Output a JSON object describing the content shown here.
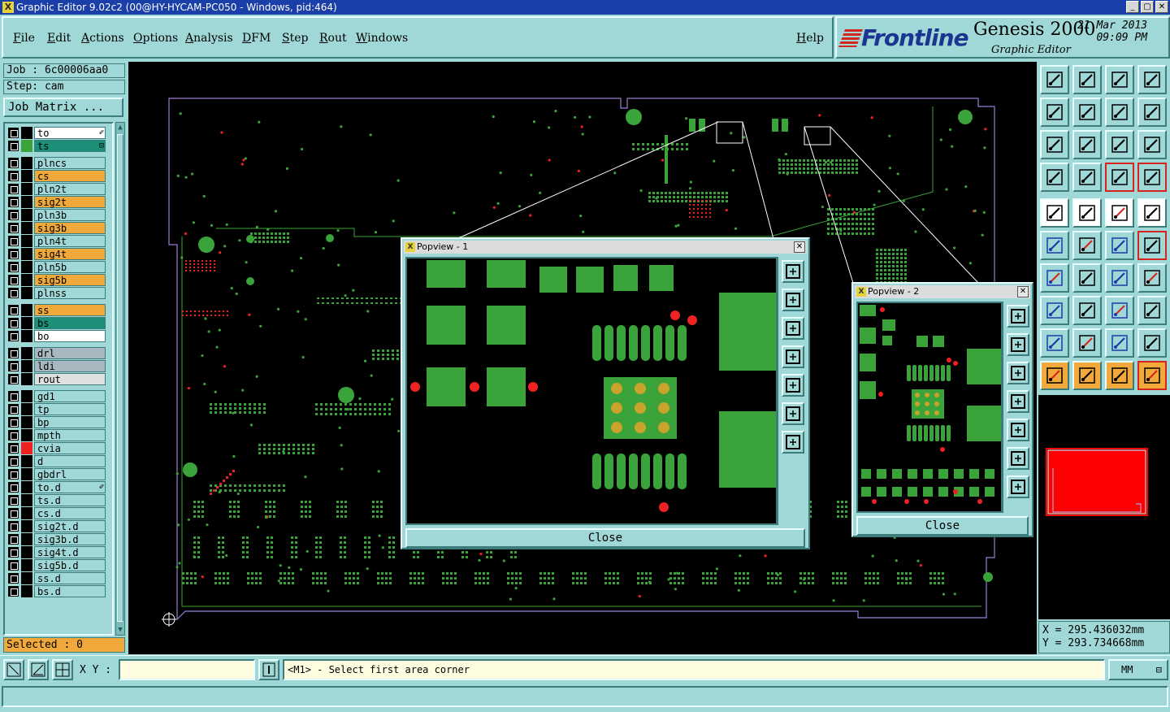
{
  "window": {
    "title": "Graphic Editor 9.02c2 (00@HY-HYCAM-PC050 - Windows, pid:464)",
    "controls": [
      "_",
      "▢",
      "✕"
    ]
  },
  "menu": {
    "items": [
      "File",
      "Edit",
      "Actions",
      "Options",
      "Analysis",
      "DFM",
      "Step",
      "Rout",
      "Windows"
    ],
    "help": "Help"
  },
  "brand": {
    "logo": "Frontline",
    "product": "Genesis 2000",
    "subtitle": "Graphic Editor",
    "date": "21 Mar 2013",
    "time": "09:09 PM"
  },
  "job": {
    "job_line": "Job : 6c00006aa0",
    "step_line": "Step: cam",
    "matrix_button": "Job Matrix ..."
  },
  "layers": [
    {
      "name": "to",
      "bg": "#ffffff",
      "swatch": "#000000",
      "mark": "✐"
    },
    {
      "name": "ts",
      "bg": "#1b8f77",
      "swatch": "#3aa33a",
      "mark": "⊡"
    },
    {
      "name": "plncs",
      "bg": "#9fd8d6",
      "swatch": "#000000",
      "mark": ""
    },
    {
      "name": "cs",
      "bg": "#f2a93b",
      "swatch": "#000000",
      "mark": ""
    },
    {
      "name": "pln2t",
      "bg": "#9fd8d6",
      "swatch": "#000000",
      "mark": ""
    },
    {
      "name": "sig2t",
      "bg": "#f2a93b",
      "swatch": "#000000",
      "mark": ""
    },
    {
      "name": "pln3b",
      "bg": "#9fd8d6",
      "swatch": "#000000",
      "mark": ""
    },
    {
      "name": "sig3b",
      "bg": "#f2a93b",
      "swatch": "#000000",
      "mark": ""
    },
    {
      "name": "pln4t",
      "bg": "#9fd8d6",
      "swatch": "#000000",
      "mark": ""
    },
    {
      "name": "sig4t",
      "bg": "#f2a93b",
      "swatch": "#000000",
      "mark": ""
    },
    {
      "name": "pln5b",
      "bg": "#9fd8d6",
      "swatch": "#000000",
      "mark": ""
    },
    {
      "name": "sig5b",
      "bg": "#f2a93b",
      "swatch": "#000000",
      "mark": ""
    },
    {
      "name": "plnss",
      "bg": "#9fd8d6",
      "swatch": "#000000",
      "mark": ""
    },
    {
      "name": "ss",
      "bg": "#f2a93b",
      "swatch": "#000000",
      "mark": ""
    },
    {
      "name": "bs",
      "bg": "#1b8f77",
      "swatch": "#000000",
      "mark": ""
    },
    {
      "name": "bo",
      "bg": "#ffffff",
      "swatch": "#000000",
      "mark": ""
    },
    {
      "name": "drl",
      "bg": "#a9b8c0",
      "swatch": "#000000",
      "mark": ""
    },
    {
      "name": "ldi",
      "bg": "#a9b8c0",
      "swatch": "#000000",
      "mark": ""
    },
    {
      "name": "rout",
      "bg": "#e0e0e0",
      "swatch": "#000000",
      "mark": ""
    },
    {
      "name": "gd1",
      "bg": "#9fd8d6",
      "swatch": "#000000",
      "mark": ""
    },
    {
      "name": "tp",
      "bg": "#9fd8d6",
      "swatch": "#000000",
      "mark": ""
    },
    {
      "name": "bp",
      "bg": "#9fd8d6",
      "swatch": "#000000",
      "mark": ""
    },
    {
      "name": "mpth",
      "bg": "#9fd8d6",
      "swatch": "#000000",
      "mark": ""
    },
    {
      "name": "cvia",
      "bg": "#9fd8d6",
      "swatch": "#ee2222",
      "mark": ""
    },
    {
      "name": "d",
      "bg": "#9fd8d6",
      "swatch": "#000000",
      "mark": ""
    },
    {
      "name": "gbdrl",
      "bg": "#9fd8d6",
      "swatch": "#000000",
      "mark": ""
    },
    {
      "name": "to.d",
      "bg": "#9fd8d6",
      "swatch": "#000000",
      "mark": "✐"
    },
    {
      "name": "ts.d",
      "bg": "#9fd8d6",
      "swatch": "#000000",
      "mark": ""
    },
    {
      "name": "cs.d",
      "bg": "#9fd8d6",
      "swatch": "#000000",
      "mark": ""
    },
    {
      "name": "sig2t.d",
      "bg": "#9fd8d6",
      "swatch": "#000000",
      "mark": ""
    },
    {
      "name": "sig3b.d",
      "bg": "#9fd8d6",
      "swatch": "#000000",
      "mark": ""
    },
    {
      "name": "sig4t.d",
      "bg": "#9fd8d6",
      "swatch": "#000000",
      "mark": ""
    },
    {
      "name": "sig5b.d",
      "bg": "#9fd8d6",
      "swatch": "#000000",
      "mark": ""
    },
    {
      "name": "ss.d",
      "bg": "#9fd8d6",
      "swatch": "#000000",
      "mark": ""
    },
    {
      "name": "bs.d",
      "bg": "#9fd8d6",
      "swatch": "#000000",
      "mark": ""
    }
  ],
  "selected_text": "Selected : 0",
  "popview1": {
    "title": "Popview - 1",
    "close_label": "Close",
    "close_x": "✕"
  },
  "popview2": {
    "title": "Popview - 2",
    "close_label": "Close",
    "close_x": "✕"
  },
  "coords": {
    "x": "X = 295.436032mm",
    "y": "Y = 293.734668mm"
  },
  "bottom": {
    "xy_label": "X Y :",
    "xy_value": "",
    "message": "<M1> - Select first area corner",
    "units": "MM",
    "units_arrow": "⊟"
  },
  "colors": {
    "pad_green": "#3aa33a",
    "via_red": "#ee2222",
    "profile_purple": "#9b7fd6",
    "bga_ball": "#c9a32c",
    "highlight_red": "#ff0000"
  },
  "toolbar_icons": [
    "open-step-icon",
    "save-icon",
    "home-icon",
    "window-split-icon",
    "zoom-left-icon",
    "zoom-right-icon",
    "undo-zoom-icon",
    "redraw-icon",
    "fit-icon",
    "center-icon",
    "scale-1-2-icon",
    "help-icon",
    "layer-props-icon",
    "grid-icon",
    "snap-icon",
    "snap-active-icon",
    "measure-icon",
    "line-tool-icon",
    "ruler-icon",
    "dot-select-icon",
    "net-icon",
    "cross-select-icon",
    "route-icon",
    "route-active-icon",
    "angle-icon",
    "slash-icon",
    "arc-icon",
    "split-icon",
    "points-icon",
    "line-cut-icon",
    "zoom-box-icon",
    "circles-icon",
    "triangle-icon",
    "triangle-cross-icon",
    "arch-icon",
    "arch-flip-icon",
    "pointer-icon",
    "pointer-box-icon",
    "pointer-active-icon",
    "connect-icon"
  ]
}
